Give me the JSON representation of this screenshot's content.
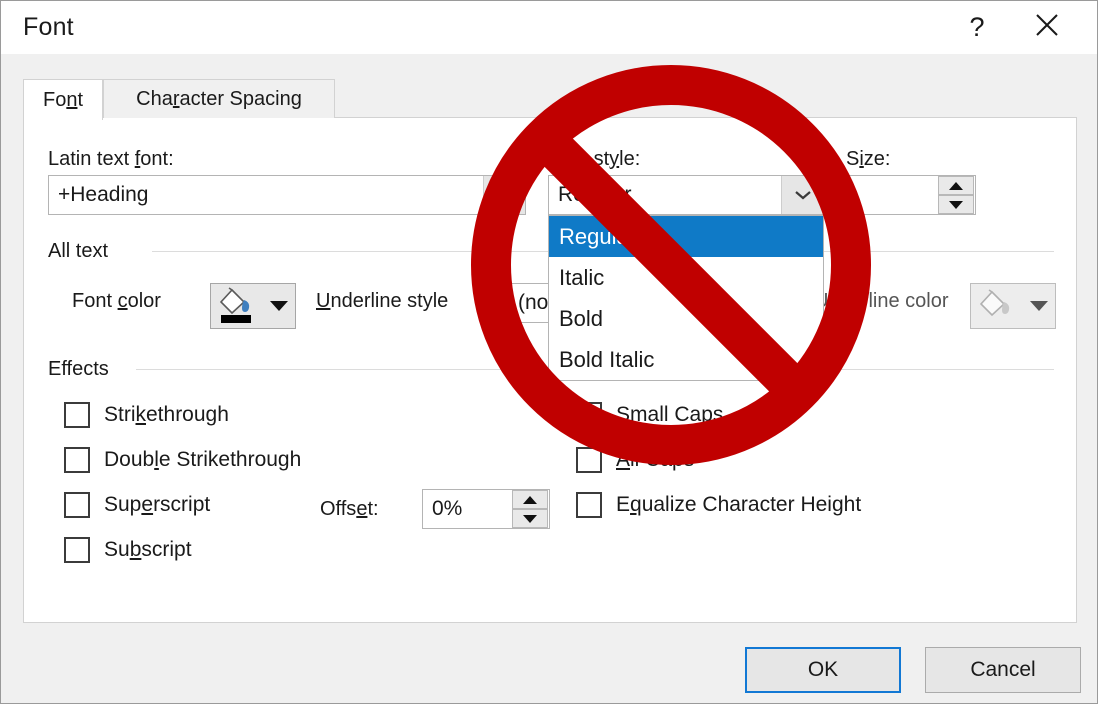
{
  "window": {
    "title": "Font",
    "help_icon": "question-mark-icon",
    "close_icon": "close-x-icon"
  },
  "tabs": [
    {
      "id": "font",
      "label": "Font",
      "accelerator": "n",
      "active": true
    },
    {
      "id": "character-spacing",
      "label": "Character Spacing",
      "accelerator": "r",
      "active": false
    }
  ],
  "fields": {
    "latin_text_font": {
      "label_pre": "Latin text ",
      "label_acc": "f",
      "label_post": "ont:",
      "value": "+Heading"
    },
    "font_style": {
      "label_pre": "Font st",
      "label_acc": "y",
      "label_post": "le:",
      "value": "Regular",
      "value_visible": "gular",
      "options": [
        "Regular",
        "Italic",
        "Bold",
        "Bold Italic"
      ],
      "selected_index": 0,
      "open": true
    },
    "size": {
      "label_pre": "S",
      "label_acc": "i",
      "label_post": "ze:",
      "value": ""
    }
  },
  "groups": {
    "all_text": {
      "title": "All text",
      "font_color": {
        "label_pre": "Font ",
        "label_acc": "c",
        "label_post": "olor",
        "icon": "paint-bucket-icon",
        "swatch_color": "#000000",
        "enabled": true
      },
      "underline_style": {
        "label_pre": "",
        "label_acc": "U",
        "label_post": "nderline style",
        "value": "(none)"
      },
      "underline_color": {
        "label_pre": "Un",
        "label_acc": "d",
        "label_post": "erline color",
        "label_visible": "derline color",
        "icon": "paint-bucket-icon",
        "enabled": false
      }
    },
    "effects": {
      "title": "Effects",
      "left_column": [
        {
          "label_pre": "Stri",
          "label_acc": "k",
          "label_post": "ethrough",
          "checked": false
        },
        {
          "label_pre": "Doub",
          "label_acc": "l",
          "label_post": "e Strikethrough",
          "checked": false
        },
        {
          "label_pre": "Sup",
          "label_acc": "e",
          "label_post": "rscript",
          "checked": false
        },
        {
          "label_pre": "Su",
          "label_acc": "b",
          "label_post": "script",
          "checked": false
        }
      ],
      "right_column": [
        {
          "label_pre": "",
          "label_acc": "S",
          "label_post": "mall Caps",
          "checked": false
        },
        {
          "label_pre": "",
          "label_acc": "A",
          "label_post": "ll Caps",
          "checked": false
        },
        {
          "label_pre": "E",
          "label_acc": "q",
          "label_post": "ualize Character Height",
          "checked": false
        }
      ],
      "offset": {
        "label_pre": "Offs",
        "label_acc": "e",
        "label_post": "t:",
        "value": "0%"
      }
    }
  },
  "footer": {
    "ok_label": "OK",
    "cancel_label": "Cancel"
  },
  "overlay": {
    "type": "prohibition-sign",
    "color": "#C00000"
  }
}
